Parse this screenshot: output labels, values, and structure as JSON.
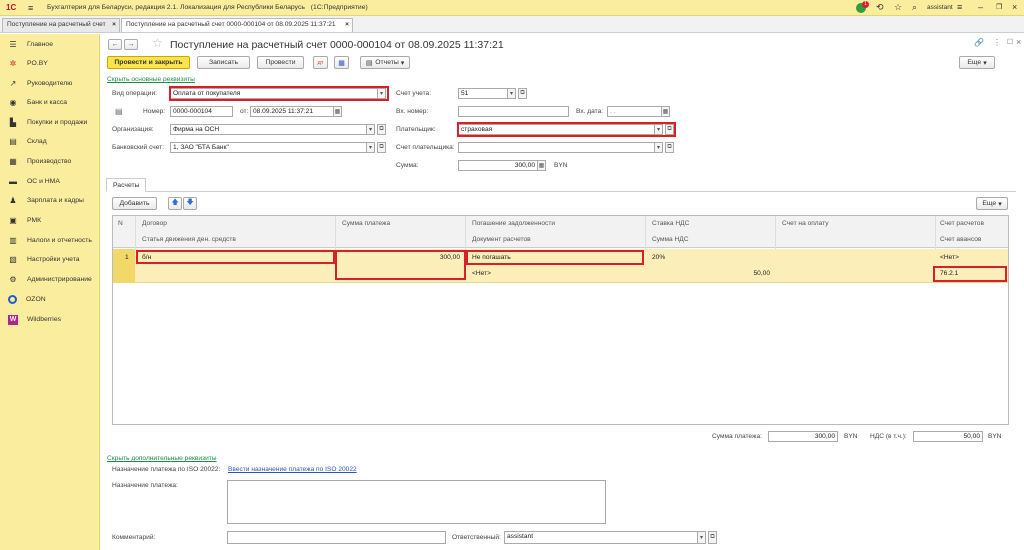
{
  "app": {
    "logo": "1С",
    "title": "Бухгалтерия для Беларуси, редакция 2.1. Локализация для Республики Беларусь",
    "platform": "(1С:Предприятие)",
    "notif_count": "1",
    "user": "assistant"
  },
  "tabs": [
    {
      "label": "Поступление на расчетный счет"
    },
    {
      "label": "Поступление на расчетный счет 0000-000104 от 08.09.2025 11:37:21"
    }
  ],
  "sidebar": {
    "items": [
      {
        "label": "Главное",
        "icon": "menu-icon"
      },
      {
        "label": "PO.BY",
        "icon": "poby-icon"
      },
      {
        "label": "Руководителю",
        "icon": "chart-icon"
      },
      {
        "label": "Банк и касса",
        "icon": "bank-icon"
      },
      {
        "label": "Покупки и продажи",
        "icon": "cart-icon"
      },
      {
        "label": "Склад",
        "icon": "warehouse-icon"
      },
      {
        "label": "Производство",
        "icon": "factory-icon"
      },
      {
        "label": "ОС и НМА",
        "icon": "truck-icon"
      },
      {
        "label": "Зарплата и кадры",
        "icon": "person-icon"
      },
      {
        "label": "РМК",
        "icon": "register-icon"
      },
      {
        "label": "Налоги и отчетность",
        "icon": "tax-icon"
      },
      {
        "label": "Настройки учета",
        "icon": "settings-doc-icon"
      },
      {
        "label": "Администрирование",
        "icon": "gear-icon"
      },
      {
        "label": "OZON",
        "icon": "ozon-icon"
      },
      {
        "label": "Wildberries",
        "icon": "wildberries-icon"
      }
    ]
  },
  "doc": {
    "title": "Поступление на расчетный счет 0000-000104 от 08.09.2025 11:37:21",
    "toolbar": {
      "post_close": "Провести и закрыть",
      "save": "Записать",
      "post": "Провести",
      "reports": "Отчеты",
      "more": "Еще"
    },
    "hide_main_link": "Скрыть основные реквизиты",
    "fields": {
      "op_type_label": "Вид операции:",
      "op_type_value": "Оплата от покупателя",
      "account_label": "Счет учета:",
      "account_value": "51",
      "number_label": "Номер:",
      "number_value": "0000-000104",
      "from_label": "от:",
      "date_value": "08.09.2025 11:37:21",
      "in_number_label": "Вх. номер:",
      "in_number_value": "",
      "in_date_label": "Вх. дата:",
      "in_date_value": ". .",
      "org_label": "Организация:",
      "org_value": "Фирма на ОСН",
      "payer_label": "Плательщик:",
      "payer_value": "страховая",
      "bank_label": "Банковский счет:",
      "bank_value": "1, ЗАО \"БТА Банк\"",
      "payer_account_label": "Счет плательщика:",
      "payer_account_value": "",
      "sum_label": "Сумма:",
      "sum_value": "300,00",
      "currency": "BYN"
    },
    "section_tab": "Расчеты",
    "table_toolbar": {
      "add": "Добавить",
      "more": "Еще"
    },
    "table": {
      "headers_top": [
        "N",
        "Договор",
        "Сумма платежа",
        "Погашение задолженности",
        "Ставка НДС",
        "Счет на оплату",
        "Счет расчетов"
      ],
      "headers_bottom": [
        "Статья движения ден. средств",
        "Документ расчетов",
        "Сумма НДС",
        "Счет авансов"
      ],
      "row": {
        "n": "1",
        "contract": "б/н",
        "amount": "300,00",
        "repayment": "Не погашать",
        "vat_rate": "20%",
        "invoice": "",
        "settle_account": "<Нет>",
        "cash_item": "",
        "settle_doc": "<Нет>",
        "vat_sum": "50,00",
        "advance_account": "76.2.1"
      }
    },
    "totals": {
      "sum_label": "Сумма платежа:",
      "sum_value": "300,00",
      "sum_currency": "BYN",
      "vat_label": "НДС (в т.ч.):",
      "vat_value": "50,00",
      "vat_currency": "BYN"
    },
    "hide_extra_link": "Скрыть дополнительные реквизиты",
    "iso_label": "Назначение платежа по ISO 20022:",
    "iso_link": "Ввести назначение платежа по ISO 20022",
    "purpose_label": "Назначение платежа:",
    "purpose_value": "",
    "comment_label": "Комментарий:",
    "comment_value": "",
    "responsible_label": "Ответственный:",
    "responsible_value": "assistant"
  }
}
